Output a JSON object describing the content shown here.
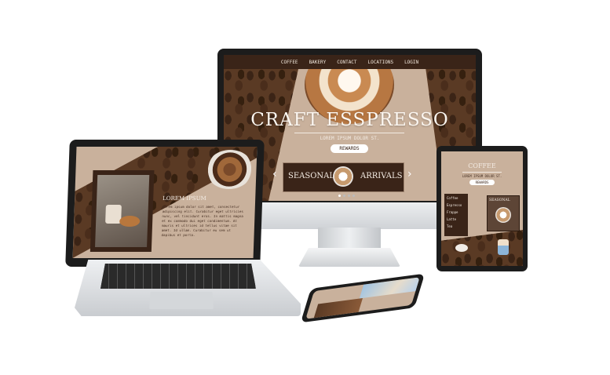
{
  "desktop": {
    "nav": [
      "COFFEE",
      "BAKERY",
      "CONTACT",
      "LOCATIONS",
      "LOGIN"
    ],
    "hero_title": "CRAFT ESSPRESSO",
    "hero_subtitle": "LOREM IPSUM DOLOR ST.",
    "rewards_button": "REWARDS",
    "banner_left": "SEASONAL",
    "banner_right": "ARRIVALS",
    "prev_arrow": "‹",
    "next_arrow": "›"
  },
  "laptop": {
    "heading": "LOREM IPSUM",
    "body": "Lorem ipsum dolor sit amet, consectetur adipiscing elit. Curabitur eget ultricies nunc, vel tincidunt eros. In mattis magna et ex commodo dui eget condimentum. At mauris et ultrices id tellus vitae sit amet. Id ullam. Curabitur eu sem ut dapibus et porta."
  },
  "tablet": {
    "title": "COFFEE",
    "subtitle": "LOREM IPSUM DOLOR ST.",
    "rewards_button": "REWARDS",
    "menu": [
      "Coffee",
      "Espresso",
      "Frappe",
      "Latte",
      "Tea"
    ],
    "card_title": "SEASONAL"
  },
  "colors": {
    "beige": "#c9b19c",
    "dark_brown": "#3a2418",
    "device_black": "#1c1c1c",
    "silver": "#d9dbde"
  }
}
